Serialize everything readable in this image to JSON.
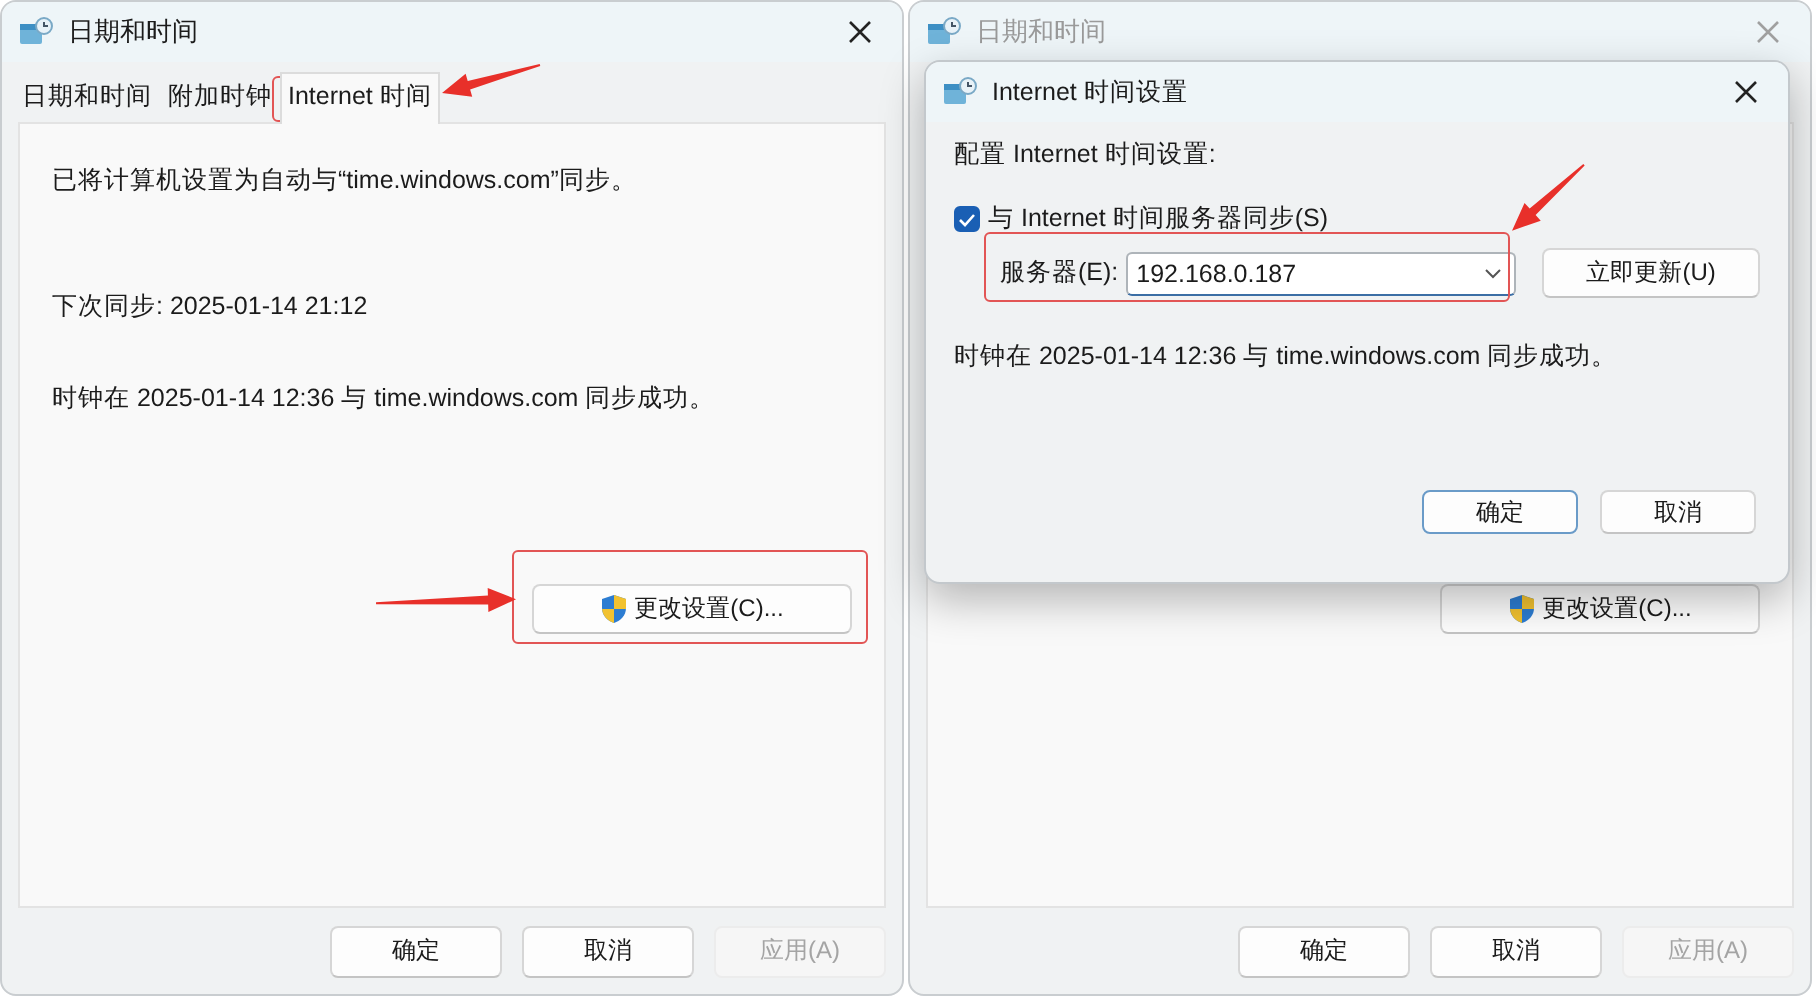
{
  "windows": [
    {
      "title": "日期和时间",
      "active": true,
      "tabs": [
        {
          "label": "日期和时间",
          "selected": false
        },
        {
          "label": "附加时钟",
          "selected": false
        },
        {
          "label": "Internet 时间",
          "selected": true
        }
      ],
      "lines": [
        "已将计算机设置为自动与“time.windows.com”同步。",
        "下次同步: 2025-01-14 21:12",
        "时钟在 2025-01-14 12:36 与 time.windows.com 同步成功。"
      ],
      "change_button": "更改设置(C)...",
      "buttons": [
        {
          "label": "确定",
          "disabled": false
        },
        {
          "label": "取消",
          "disabled": false
        },
        {
          "label": "应用(A)",
          "disabled": true
        }
      ]
    },
    {
      "title": "日期和时间",
      "active": false,
      "change_button": "更改设置(C)...",
      "buttons": [
        {
          "label": "确定",
          "disabled": false
        },
        {
          "label": "取消",
          "disabled": false
        },
        {
          "label": "应用(A)",
          "disabled": true
        }
      ]
    }
  ],
  "dialog": {
    "title": "Internet 时间设置",
    "heading": "配置 Internet 时间设置:",
    "sync": {
      "label": "与 Internet 时间服务器同步(S)",
      "checked": true
    },
    "server": {
      "label": "服务器(E):",
      "value": "192.168.0.187"
    },
    "update_button": "立即更新(U)",
    "status": "时钟在 2025-01-14 12:36 与 time.windows.com 同步成功。",
    "buttons": [
      {
        "label": "确定",
        "default": true
      },
      {
        "label": "取消",
        "default": false
      }
    ]
  }
}
